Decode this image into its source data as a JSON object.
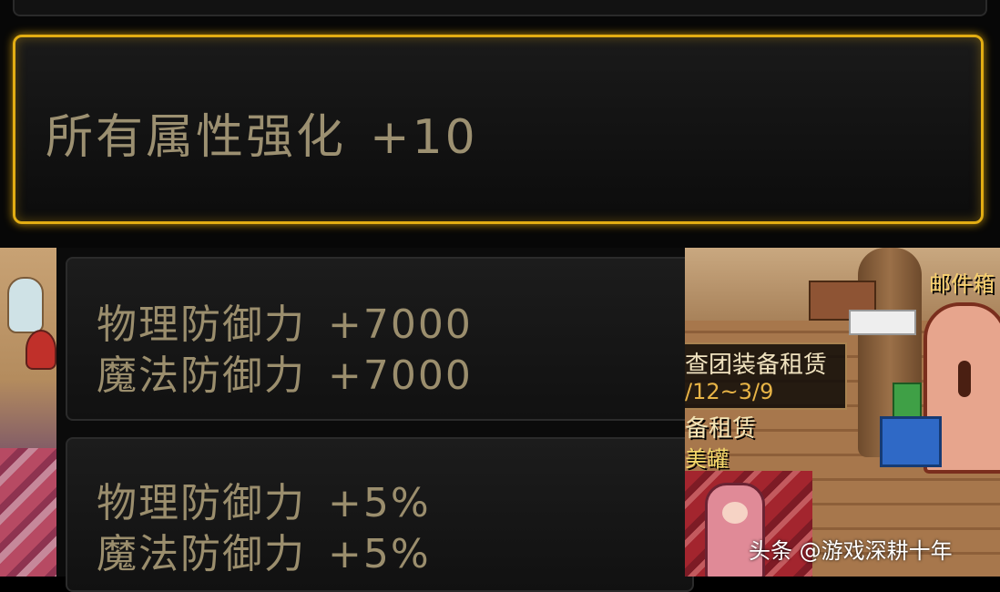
{
  "highlight_stat": {
    "name": "所有属性强化",
    "value": "+10"
  },
  "stat_group_1": [
    {
      "name": "物理防御力",
      "value": "+7000"
    },
    {
      "name": "魔法防御力",
      "value": "+7000"
    }
  ],
  "stat_group_2": [
    {
      "name": "物理防御力",
      "value": "+5%"
    },
    {
      "name": "魔法防御力",
      "value": "+5%"
    }
  ],
  "scene": {
    "tooltip_title": "查团装备租赁",
    "tooltip_date": "/12~3/9",
    "npc_name": "备租赁",
    "npc_sub": "美罐",
    "mailbox_label": "邮件箱"
  },
  "watermark": "头条 @游戏深耕十年",
  "colors": {
    "highlight_border": "#e2ad13",
    "stat_text": "#9b8e6d"
  }
}
